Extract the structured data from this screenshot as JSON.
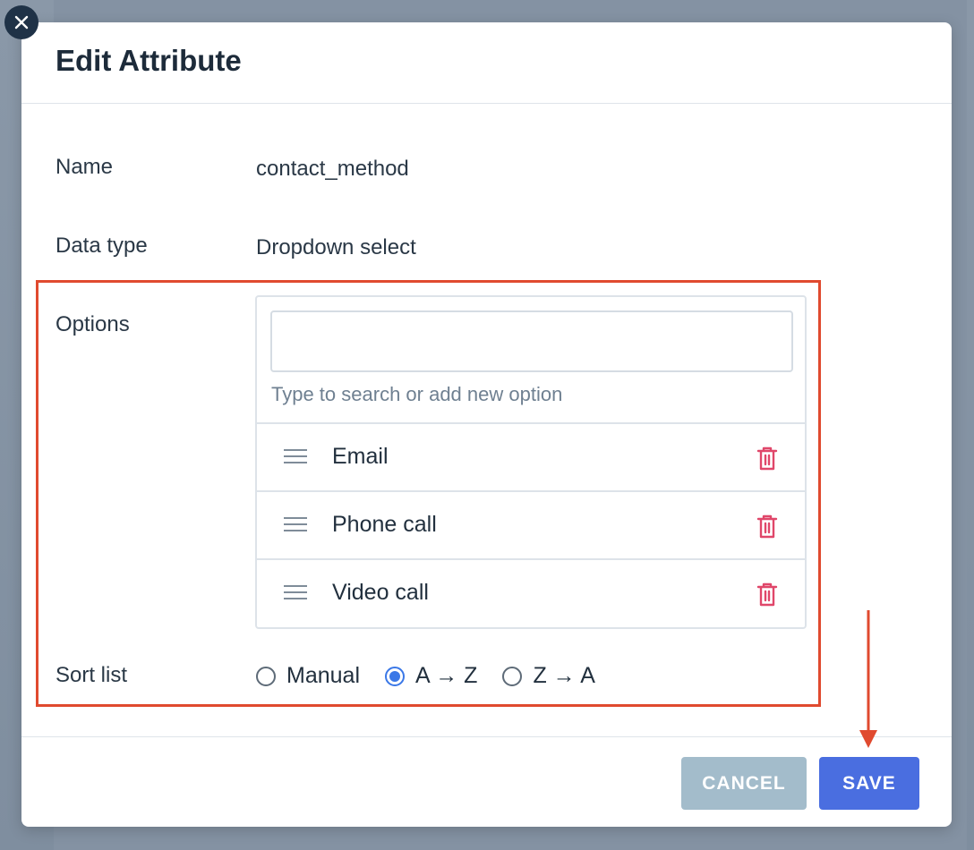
{
  "modal": {
    "title": "Edit Attribute"
  },
  "fields": {
    "name_label": "Name",
    "name_value": "contact_method",
    "datatype_label": "Data type",
    "datatype_value": "Dropdown select",
    "options_label": "Options",
    "sort_label": "Sort list"
  },
  "options_editor": {
    "search_value": "",
    "search_hint": "Type to search or add new option",
    "items": [
      {
        "label": "Email"
      },
      {
        "label": "Phone call"
      },
      {
        "label": "Video call"
      }
    ]
  },
  "sort": {
    "options": [
      {
        "label": "Manual",
        "selected": false
      },
      {
        "label": "A → Z",
        "selected": true
      },
      {
        "label": "Z → A",
        "selected": false
      }
    ]
  },
  "footer": {
    "cancel_label": "CANCEL",
    "save_label": "SAVE"
  },
  "colors": {
    "highlight": "#e04a2f",
    "save_button": "#4a6ee0",
    "cancel_button": "#a3bccb",
    "trash_icon": "#e0476a",
    "radio_selected": "#3b78e7"
  },
  "icons": {
    "close": "close-icon",
    "drag": "drag-handle-icon",
    "delete": "trash-icon"
  }
}
